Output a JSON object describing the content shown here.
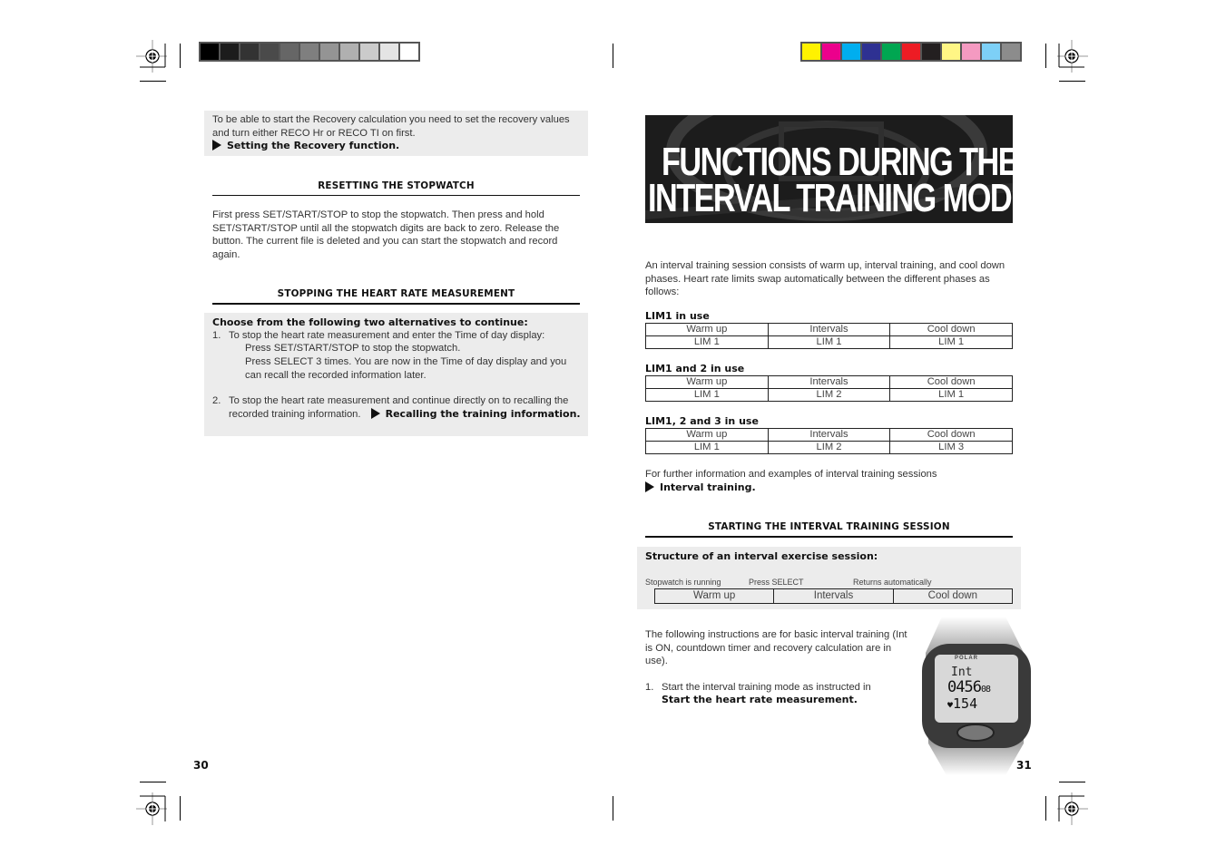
{
  "print_marks": {
    "grayscale_swatches": [
      "#000000",
      "#1c1c1c",
      "#333333",
      "#4a4a4a",
      "#666666",
      "#7f7f7f",
      "#949494",
      "#b0b0b0",
      "#cbcbcb",
      "#e4e4e4",
      "#ffffff"
    ],
    "color_swatches": [
      "#fff200",
      "#ec008c",
      "#00aeef",
      "#2e3192",
      "#00a651",
      "#ed1c24",
      "#231f20",
      "#fff685",
      "#f49ac1",
      "#7dd0f7",
      "#8c8c8c"
    ]
  },
  "left_page": {
    "intro_box": {
      "text": "To be able to start the Recovery calculation you need to set the recovery values and turn either RECO Hr or RECO TI on first.",
      "link": "Setting the Recovery function."
    },
    "resetting": {
      "heading": "RESETTING THE STOPWATCH",
      "body": "First press SET/START/STOP to stop the stopwatch. Then press and hold SET/START/STOP until all the stopwatch digits are back to zero. Release the button. The current file is deleted and you can start the stopwatch and record again."
    },
    "stopping": {
      "heading": "STOPPING THE HEART RATE MEASUREMENT",
      "box_title": "Choose from the following two alternatives to continue:",
      "item1_num": "1.",
      "item1_text": "To stop the heart rate measurement and enter the Time of day display:",
      "item1_sub1": "Press SET/START/STOP to stop the stopwatch.",
      "item1_sub2": "Press SELECT 3 times. You are now in the Time of day display and you can recall the recorded information later.",
      "item2_num": "2.",
      "item2_text": "To stop the heart rate measurement and continue directly on to recalling the recorded training information.",
      "item2_link": "Recalling the training information."
    },
    "page_number": "30"
  },
  "right_page": {
    "banner": {
      "line1": "FUNCTIONS DURING THE",
      "line2": "INTERVAL TRAINING MODE"
    },
    "intro": "An interval training session consists of warm up, interval training, and cool down phases. Heart rate limits swap automatically between the different phases as follows:",
    "tables": [
      {
        "title": "LIM1 in use",
        "header": [
          "Warm up",
          "Intervals",
          "Cool down"
        ],
        "row": [
          "LIM 1",
          "LIM 1",
          "LIM 1"
        ]
      },
      {
        "title": "LIM1 and 2 in use",
        "header": [
          "Warm up",
          "Intervals",
          "Cool down"
        ],
        "row": [
          "LIM 1",
          "LIM 2",
          "LIM 1"
        ]
      },
      {
        "title": "LIM1, 2 and 3 in use",
        "header": [
          "Warm up",
          "Intervals",
          "Cool down"
        ],
        "row": [
          "LIM 1",
          "LIM 2",
          "LIM 3"
        ]
      }
    ],
    "further": {
      "text": "For further information and examples of interval training sessions",
      "link": "Interval training."
    },
    "starting": {
      "heading": "STARTING THE INTERVAL TRAINING SESSION",
      "box_title": "Structure of an interval exercise session:",
      "label1": "Stopwatch is running",
      "label2": "Press SELECT",
      "label3": "Returns automatically",
      "phases": [
        "Warm up",
        "Intervals",
        "Cool down"
      ]
    },
    "instructions": "The following instructions are for basic interval training (Int is ON, countdown timer and recovery calculation are in use).",
    "step1_num": "1.",
    "step1_text": "Start the interval training mode as instructed in",
    "step1_link": "Start the heart rate measurement.",
    "watch": {
      "brand": "POLAR",
      "line1": "Int",
      "time": "0456",
      "seconds": "08",
      "heart_rate": "154"
    },
    "page_number": "31"
  }
}
